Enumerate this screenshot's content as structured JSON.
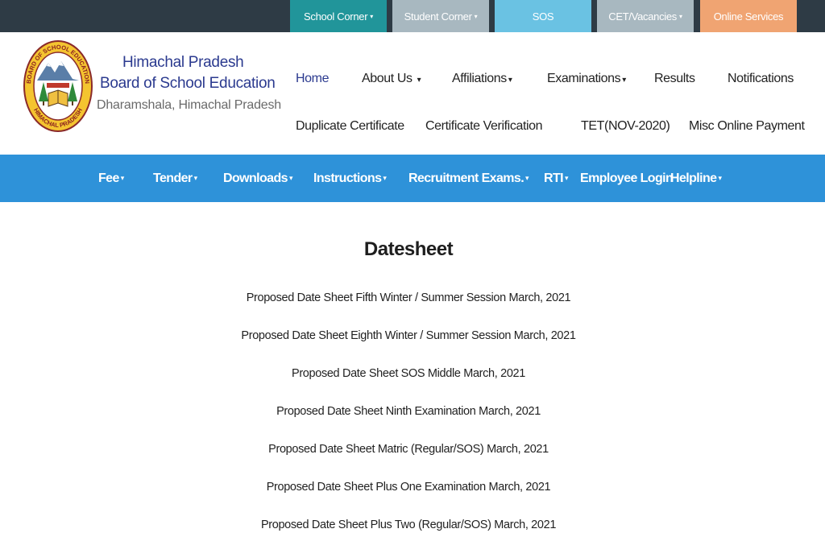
{
  "topbar": {
    "items": [
      {
        "label": "School Corner",
        "caret": "▾",
        "bg": "#21959a"
      },
      {
        "label": "Student Corner",
        "caret": "▾",
        "bg": "#a8b8c0"
      },
      {
        "label": "SOS",
        "caret": "",
        "bg": "#6ac2e3"
      },
      {
        "label": "CET/Vacancies",
        "caret": "▾",
        "bg": "#a8b8c0"
      },
      {
        "label": "Online Services",
        "caret": "",
        "bg": "#f0a472"
      }
    ],
    "bg": "#2e3b45"
  },
  "brand": {
    "line1": "Himachal Pradesh",
    "line2": "Board of School Education",
    "line3": "Dharamshala, Himachal Pradesh",
    "color": "#2b3a8f"
  },
  "header_nav": {
    "row1": [
      {
        "label": "Home",
        "caret": ""
      },
      {
        "label": "About Us",
        "caret": "▾"
      },
      {
        "label": "Affiliations",
        "caret": "▾"
      },
      {
        "label": "Examinations",
        "caret": "▾"
      },
      {
        "label": "Results",
        "caret": ""
      },
      {
        "label": "Notifications",
        "caret": ""
      }
    ],
    "row2": [
      {
        "label": "Duplicate Certificate"
      },
      {
        "label": "Certificate Verification"
      },
      {
        "label": "TET(NOV-2020)"
      },
      {
        "label": "Misc Online Payment"
      }
    ]
  },
  "main_nav": {
    "bg": "#2e92d9",
    "items": [
      {
        "label": "Fee",
        "caret": "▾"
      },
      {
        "label": "Tender",
        "caret": "▾"
      },
      {
        "label": "Downloads",
        "caret": "▾"
      },
      {
        "label": "Instructions",
        "caret": "▾"
      },
      {
        "label": "Recruitment Exams.",
        "caret": "▾"
      },
      {
        "label": "RTI",
        "caret": "▾"
      },
      {
        "label": "Employee Login",
        "caret": ""
      },
      {
        "label": "Helpline",
        "caret": "▾"
      }
    ]
  },
  "page": {
    "title": "Datesheet",
    "items": [
      "Proposed Date Sheet Fifth Winter / Summer Session March, 2021",
      "Proposed Date Sheet Eighth Winter / Summer Session March, 2021",
      "Proposed Date Sheet SOS Middle March, 2021",
      "Proposed Date Sheet Ninth Examination March, 2021",
      "Proposed Date Sheet Matric (Regular/SOS) March, 2021",
      "Proposed Date Sheet Plus One Examination March, 2021",
      "Proposed Date Sheet Plus Two (Regular/SOS) March, 2021"
    ]
  },
  "logo": {
    "icon": "board-seal-icon",
    "ring_text_top": "BOARD OF SCHOOL EDUCATION",
    "ring_text_bottom": "HIMACHAL PRADESH"
  }
}
